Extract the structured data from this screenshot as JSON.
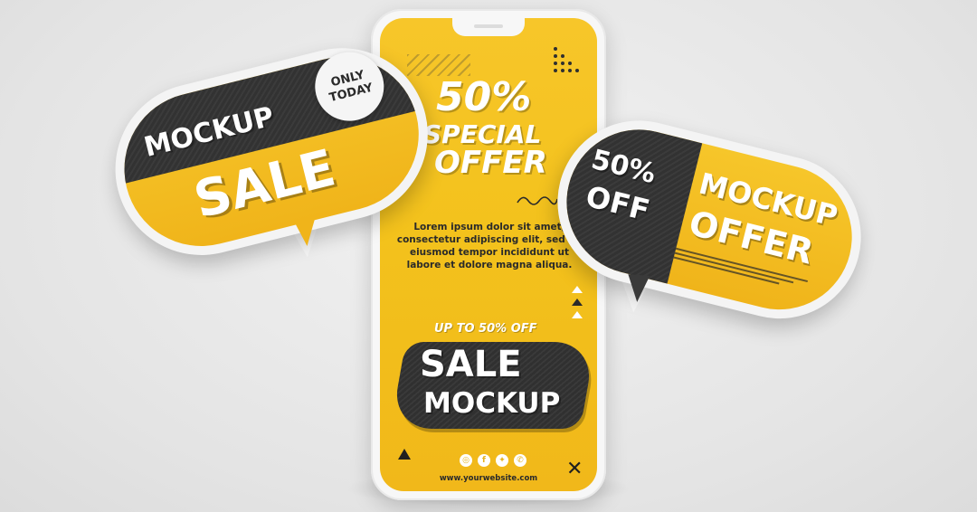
{
  "phone": {
    "headline_percent": "50%",
    "headline_special": "SPECIAL",
    "headline_offer": "OFFER",
    "lorem": "Lorem ipsum dolor sit amet, consectetur adipiscing elit, sed do eiusmod tempor incididunt ut labore et dolore magna aliqua.",
    "up_to": "UP TO 50% OFF",
    "sale": "SALE",
    "mockup": "MOCKUP",
    "website": "www.yourwebsite.com",
    "close_glyph": "✕",
    "social_icons": [
      "instagram-icon",
      "facebook-icon",
      "twitter-icon",
      "whatsapp-icon"
    ]
  },
  "left_bubble": {
    "mockup": "MOCKUP",
    "sale": "SALE",
    "badge_line1": "ONLY",
    "badge_line2": "TODAY"
  },
  "right_bubble": {
    "percent": "50%",
    "off": "OFF",
    "mockup": "MOCKUP",
    "offer": "OFFER"
  },
  "colors": {
    "yellow": "#f3c21c",
    "dark": "#333333",
    "white": "#ffffff",
    "background": "#e6e6e6"
  }
}
